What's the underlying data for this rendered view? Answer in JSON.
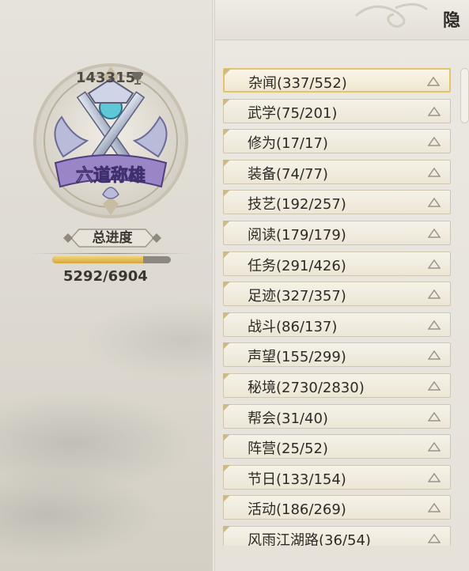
{
  "header": {
    "hidden_tab_label": "隐"
  },
  "player": {
    "score": "143315",
    "emblem_title": "六道称雄",
    "progress_label": "总进度",
    "progress_text": "5292/6904",
    "progress_fraction": 0.7665
  },
  "categories": [
    {
      "label": "杂闻(337/552)"
    },
    {
      "label": "武学(75/201)"
    },
    {
      "label": "修为(17/17)"
    },
    {
      "label": "装备(74/77)"
    },
    {
      "label": "技艺(192/257)"
    },
    {
      "label": "阅读(179/179)"
    },
    {
      "label": "任务(291/426)"
    },
    {
      "label": "足迹(327/357)"
    },
    {
      "label": "战斗(86/137)"
    },
    {
      "label": "声望(155/299)"
    },
    {
      "label": "秘境(2730/2830)"
    },
    {
      "label": "帮会(31/40)"
    },
    {
      "label": "阵营(25/52)"
    },
    {
      "label": "节日(133/154)"
    },
    {
      "label": "活动(186/269)"
    },
    {
      "label": "风雨江湖路(36/54)"
    }
  ],
  "colors": {
    "accent_gold": "#e2c46a",
    "progress_fill": "#d5a73c",
    "text_dark": "#2e2a25"
  },
  "icons": {
    "score": "trophy-icon",
    "emblem": "crossed-swords-emblem-icon",
    "category_arrow": "triangle-up-icon"
  }
}
